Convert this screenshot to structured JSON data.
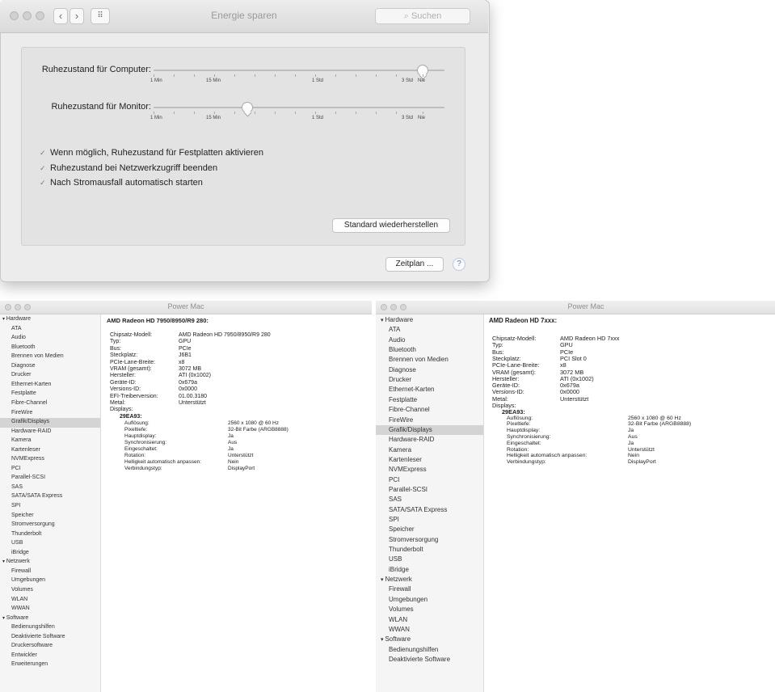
{
  "energy": {
    "title": "Energie sparen",
    "search_placeholder": "Suchen",
    "grid_icon_label": "⠿",
    "computer_label": "Ruhezustand für Computer:",
    "monitor_label": "Ruhezustand für Monitor:",
    "slider_ticks": [
      "1 Min",
      "15 Min",
      "1 Std",
      "3 Std",
      "Nie"
    ],
    "computer_value": "Nie",
    "monitor_value": "15 Min",
    "checkboxes": [
      {
        "label": "Wenn möglich, Ruhezustand für Festplatten aktivieren",
        "checked": true
      },
      {
        "label": "Ruhezustand bei Netzwerkzugriff beenden",
        "checked": true
      },
      {
        "label": "Nach Stromausfall automatisch starten",
        "checked": true
      }
    ],
    "restore_button": "Standard wiederherstellen",
    "schedule_button": "Zeitplan ...",
    "help": "?"
  },
  "left_report": {
    "title": "Power Mac",
    "header": "AMD Radeon HD 7950/8950/R9 280:",
    "selected": "Grafik/Displays",
    "sidebar": [
      {
        "label": "Hardware",
        "group": true
      },
      {
        "label": "ATA"
      },
      {
        "label": "Audio"
      },
      {
        "label": "Bluetooth"
      },
      {
        "label": "Brennen von Medien"
      },
      {
        "label": "Diagnose"
      },
      {
        "label": "Drucker"
      },
      {
        "label": "Ethernet-Karten"
      },
      {
        "label": "Festplatte"
      },
      {
        "label": "Fibre-Channel"
      },
      {
        "label": "FireWire"
      },
      {
        "label": "Grafik/Displays"
      },
      {
        "label": "Hardware-RAID"
      },
      {
        "label": "Kamera"
      },
      {
        "label": "Kartenleser"
      },
      {
        "label": "NVMExpress"
      },
      {
        "label": "PCI"
      },
      {
        "label": "Parallel-SCSI"
      },
      {
        "label": "SAS"
      },
      {
        "label": "SATA/SATA Express"
      },
      {
        "label": "SPI"
      },
      {
        "label": "Speicher"
      },
      {
        "label": "Stromversorgung"
      },
      {
        "label": "Thunderbolt"
      },
      {
        "label": "USB"
      },
      {
        "label": "iBridge"
      },
      {
        "label": "Netzwerk",
        "group": true
      },
      {
        "label": "Firewall"
      },
      {
        "label": "Umgebungen"
      },
      {
        "label": "Volumes"
      },
      {
        "label": "WLAN"
      },
      {
        "label": "WWAN"
      },
      {
        "label": "Software",
        "group": true
      },
      {
        "label": "Bedienungshilfen"
      },
      {
        "label": "Deaktivierte Software"
      },
      {
        "label": "Druckersoftware"
      },
      {
        "label": "Entwickler"
      },
      {
        "label": "Erweiterungen"
      }
    ],
    "details": [
      [
        "Chipsatz-Modell:",
        "AMD Radeon HD 7950/8950/R9 280"
      ],
      [
        "Typ:",
        "GPU"
      ],
      [
        "Bus:",
        "PCIe"
      ],
      [
        "Steckplatz:",
        "J6B1"
      ],
      [
        "PCIe-Lane-Breite:",
        "x8"
      ],
      [
        "VRAM (gesamt):",
        "3072 MB"
      ],
      [
        "Hersteller:",
        "ATI (0x1002)"
      ],
      [
        "Geräte-ID:",
        "0x679a"
      ],
      [
        "Versions-ID:",
        "0x0000"
      ],
      [
        "EFI-Treiberversion:",
        "01.00.3180"
      ],
      [
        "Metal:",
        "Unterstützt"
      ],
      [
        "Displays:",
        ""
      ]
    ],
    "display_name": "29EA93:",
    "display_details": [
      [
        "Auflösung:",
        "2560 x 1080 @ 60 Hz"
      ],
      [
        "Pixeltiefe:",
        "32-Bit Farbe (ARGB8888)"
      ],
      [
        "Hauptdisplay:",
        "Ja"
      ],
      [
        "Synchronisierung:",
        "Aus"
      ],
      [
        "Eingeschaltet:",
        "Ja"
      ],
      [
        "Rotation:",
        "Unterstützt"
      ],
      [
        "Helligkeit automatisch anpassen:",
        "Nein"
      ],
      [
        "Verbindungstyp:",
        "DisplayPort"
      ]
    ]
  },
  "right_report": {
    "title": "Power Mac",
    "header": "AMD Radeon HD 7xxx:",
    "selected": "Grafik/Displays",
    "sidebar": [
      {
        "label": "Hardware",
        "group": true
      },
      {
        "label": "ATA"
      },
      {
        "label": "Audio"
      },
      {
        "label": "Bluetooth"
      },
      {
        "label": "Brennen von Medien"
      },
      {
        "label": "Diagnose"
      },
      {
        "label": "Drucker"
      },
      {
        "label": "Ethernet-Karten"
      },
      {
        "label": "Festplatte"
      },
      {
        "label": "Fibre-Channel"
      },
      {
        "label": "FireWire"
      },
      {
        "label": "Grafik/Displays"
      },
      {
        "label": "Hardware-RAID"
      },
      {
        "label": "Kamera"
      },
      {
        "label": "Kartenleser"
      },
      {
        "label": "NVMExpress"
      },
      {
        "label": "PCI"
      },
      {
        "label": "Parallel-SCSI"
      },
      {
        "label": "SAS"
      },
      {
        "label": "SATA/SATA Express"
      },
      {
        "label": "SPI"
      },
      {
        "label": "Speicher"
      },
      {
        "label": "Stromversorgung"
      },
      {
        "label": "Thunderbolt"
      },
      {
        "label": "USB"
      },
      {
        "label": "iBridge"
      },
      {
        "label": "Netzwerk",
        "group": true
      },
      {
        "label": "Firewall"
      },
      {
        "label": "Umgebungen"
      },
      {
        "label": "Volumes"
      },
      {
        "label": "WLAN"
      },
      {
        "label": "WWAN"
      },
      {
        "label": "Software",
        "group": true
      },
      {
        "label": "Bedienungshilfen"
      },
      {
        "label": "Deaktivierte Software"
      }
    ],
    "details": [
      [
        "Chipsatz-Modell:",
        "AMD Radeon HD 7xxx"
      ],
      [
        "Typ:",
        "GPU"
      ],
      [
        "Bus:",
        "PCIe"
      ],
      [
        "Steckplatz:",
        "PCI Slot 0"
      ],
      [
        "PCIe-Lane-Breite:",
        "x8"
      ],
      [
        "VRAM (gesamt):",
        "3072 MB"
      ],
      [
        "Hersteller:",
        "ATI (0x1002)"
      ],
      [
        "Geräte-ID:",
        "0x679a"
      ],
      [
        "Versions-ID:",
        "0x0000"
      ],
      [
        "Metal:",
        "Unterstützt"
      ],
      [
        "Displays:",
        ""
      ]
    ],
    "display_name": "29EA93:",
    "display_details": [
      [
        "Auflösung:",
        "2560 x 1080 @ 60 Hz"
      ],
      [
        "Pixeltiefe:",
        "32-Bit Farbe (ARGB8888)"
      ],
      [
        "Hauptdisplay:",
        "Ja"
      ],
      [
        "Synchronisierung:",
        "Aus"
      ],
      [
        "Eingeschaltet:",
        "Ja"
      ],
      [
        "Rotation:",
        "Unterstützt"
      ],
      [
        "Helligkeit automatisch anpassen:",
        "Nein"
      ],
      [
        "Verbindungstyp:",
        "DisplayPort"
      ]
    ]
  }
}
